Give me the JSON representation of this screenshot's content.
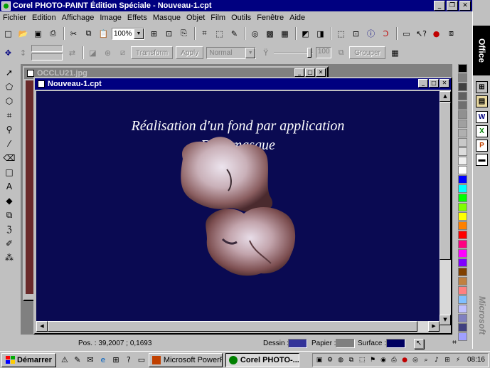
{
  "window": {
    "title": "Corel PHOTO-PAINT Édition Spéciale - Nouveau-1.cpt",
    "buttons": [
      "_",
      "❐",
      "✕"
    ]
  },
  "menu": [
    "Fichier",
    "Edition",
    "Affichage",
    "Image",
    "Effets",
    "Masque",
    "Objet",
    "Film",
    "Outils",
    "Fenêtre",
    "Aide"
  ],
  "toolbar": {
    "zoom": "100%",
    "transform_label": "Transform",
    "apply_label": "Apply",
    "mode": "Normal",
    "opacity": "100",
    "group_label": "Grouper"
  },
  "documents": {
    "back": {
      "title": "OCCLU21.jpg"
    },
    "front": {
      "title": "Nouveau-1.cpt",
      "caption_line1": "Réalisation d'un fond par application",
      "caption_line2": "D'un masque"
    }
  },
  "status": {
    "position": "Pos. : 39,2007 ; 0,1693",
    "dessin_label": "Dessin :",
    "papier_label": "Papier :",
    "surface_label": "Surface :",
    "dessin_color": "#333399",
    "papier_color": "#808080",
    "surface_color": "#000060"
  },
  "office": {
    "label": "Office",
    "brand": "Microsoft"
  },
  "taskbar": {
    "start_label": "Démarrer",
    "tasks": [
      "Microsoft PowerPo...",
      "Corel PHOTO-..."
    ],
    "clock": "08:16"
  },
  "palette_colors": [
    "#000000",
    "#808080",
    "#404040",
    "#606060",
    "#707070",
    "#909090",
    "#a0a0a0",
    "#b0b0b0",
    "#c8c8c8",
    "#dcdcdc",
    "#f0f0f0",
    "#ffffff",
    "#0000ff",
    "#00ffff",
    "#00ff00",
    "#80ff00",
    "#ffff00",
    "#ff8000",
    "#ff0000",
    "#ff0080",
    "#ff00ff",
    "#8000ff",
    "#804000",
    "#c08040",
    "#ff8080",
    "#80c0ff",
    "#c0c0ff",
    "#8080c0",
    "#404080",
    "#a0a0ff"
  ]
}
